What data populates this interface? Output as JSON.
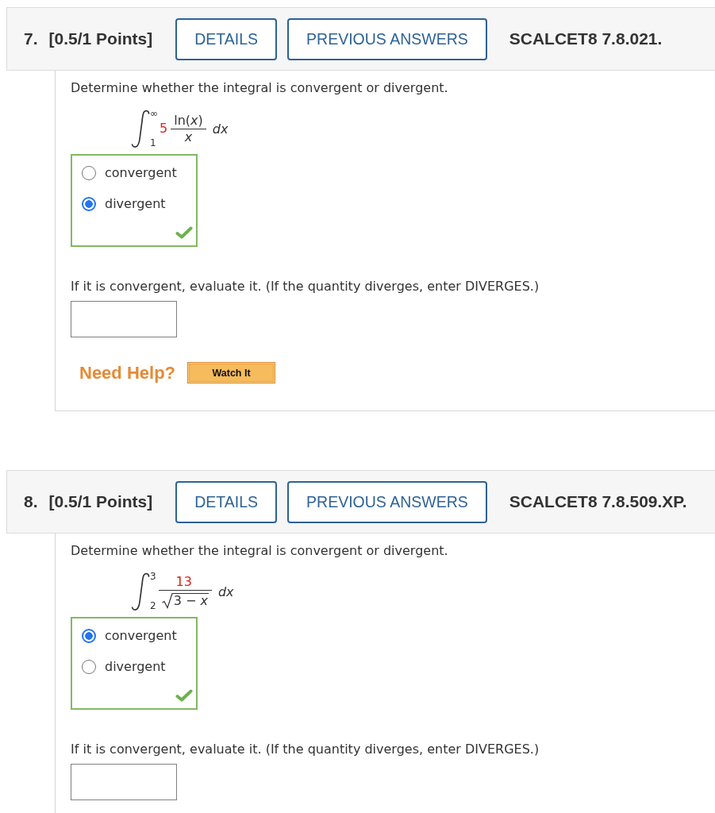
{
  "questions": [
    {
      "number": "7.",
      "points": "[0.5/1 Points]",
      "buttons": [
        {
          "label": "DETAILS"
        },
        {
          "label": "PREVIOUS ANSWERS"
        }
      ],
      "reference": "SCALCET8 7.8.021.",
      "prompt": "Determine whether the integral is convergent or divergent.",
      "integral": {
        "upper": "∞",
        "lower": "1",
        "integrand": [
          {
            "kind": "value",
            "text": "5"
          },
          {
            "kind": "fraction",
            "numerator": {
              "kind": "expression",
              "text": "ln(*x*)"
            },
            "denominator": {
              "kind": "variable",
              "text": "x"
            }
          }
        ],
        "differential": "dx"
      },
      "choices": {
        "correct": true,
        "options": [
          {
            "label": "convergent",
            "selected": false
          },
          {
            "label": "divergent",
            "selected": true
          }
        ]
      },
      "instruction": "If it is convergent, evaluate it. (If the quantity diverges, enter DIVERGES.)",
      "help": {
        "label": "Need Help?",
        "button": "Watch It"
      }
    },
    {
      "number": "8.",
      "points": "[0.5/1 Points]",
      "buttons": [
        {
          "label": "DETAILS"
        },
        {
          "label": "PREVIOUS ANSWERS"
        }
      ],
      "reference": "SCALCET8 7.8.509.XP.",
      "prompt": "Determine whether the integral is convergent or divergent.",
      "integral": {
        "upper": "3",
        "lower": "2",
        "integrand": [
          {
            "kind": "fraction",
            "numerator": {
              "kind": "value",
              "text": "13"
            },
            "denominator": {
              "kind": "radical",
              "text": "3 − *x*"
            }
          }
        ],
        "differential": "dx"
      },
      "choices": {
        "correct": true,
        "options": [
          {
            "label": "convergent",
            "selected": true
          },
          {
            "label": "divergent",
            "selected": false
          }
        ]
      },
      "instruction": "If it is convergent, evaluate it. (If the quantity diverges, enter DIVERGES.)"
    }
  ]
}
